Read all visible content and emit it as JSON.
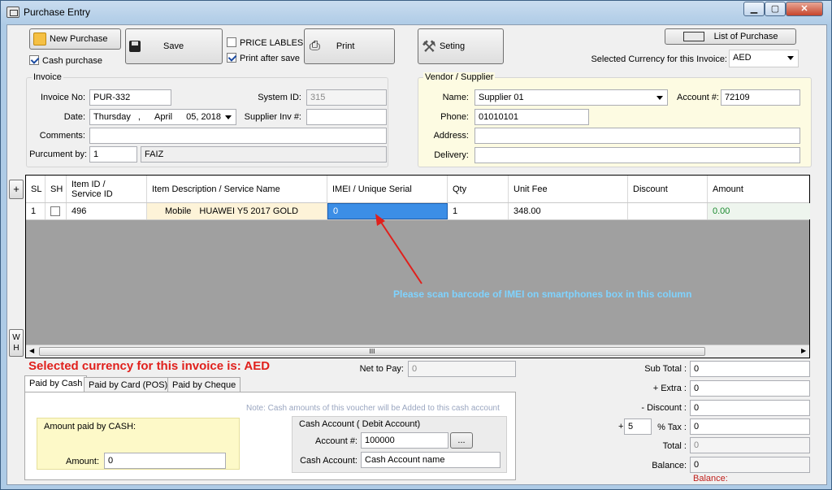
{
  "window": {
    "title": "Purchase Entry",
    "min": "▁",
    "max": "▢",
    "close": "✕"
  },
  "toolbar": {
    "new_purchase": "New Purchase",
    "save": "Save",
    "print": "Print",
    "setting": "Seting",
    "list_of_purchase": "List of Purchase",
    "cash_purchase": "Cash purchase",
    "price_lables": "PRICE LABLES",
    "print_after_save": "Print after save"
  },
  "currency": {
    "label": "Selected Currency for this Invoice:",
    "value": "AED"
  },
  "invoice": {
    "title": "Invoice",
    "invoice_no_label": "Invoice No:",
    "invoice_no": "PUR-332",
    "system_id_label": "System ID:",
    "system_id": "315",
    "date_label": "Date:",
    "date_day": "Thursday",
    "date_sep": ",",
    "date_month": "April",
    "date_rest": "05, 2018",
    "supplier_inv_label": "Supplier Inv #:",
    "supplier_inv": "",
    "comments_label": "Comments:",
    "comments": "",
    "purcument_label": "Purcument by:",
    "purcument_id": "1",
    "purcument_name": "FAIZ"
  },
  "vendor": {
    "title": "Vendor / Supplier",
    "name_label": "Name:",
    "name": "Supplier 01",
    "account_label": "Account #:",
    "account": "72109",
    "phone_label": "Phone:",
    "phone": "01010101",
    "address_label": "Address:",
    "address": "",
    "delivery_label": "Delivery:",
    "delivery": ""
  },
  "grid": {
    "columns": [
      "SL",
      "SH",
      "Item ID /\nService ID",
      "Item Description  / Service Name",
      "IMEI / Unique Serial",
      "Qty",
      "Unit Fee",
      "Discount",
      "Amount"
    ],
    "row": {
      "sl": "1",
      "item_id": "496",
      "desc_type": "Mobile",
      "desc_name": "HUAWEI Y5 2017 GOLD",
      "imei": "0",
      "qty": "1",
      "unit_fee": "348.00",
      "discount": "",
      "amount": "0.00"
    },
    "annotation": "Please scan barcode of IMEI on smartphones box in this column",
    "scroll_grip": "III",
    "plus_btn": "+",
    "wh_btn": "W\nH"
  },
  "currency_banner": "Selected currency for this invoice is: AED",
  "net_to_pay": {
    "label": "Net to Pay:",
    "value": "0"
  },
  "tabs": [
    "Paid by Cash",
    "Paid by Card (POS)",
    "Paid by Cheque"
  ],
  "cash": {
    "note": "Note: Cash amounts of this voucher will be Added to  this cash account",
    "amount_group": "Amount paid by CASH:",
    "amount_label": "Amount:",
    "amount": "0",
    "account_group": "Cash Account ( Debit Account)",
    "account_no_label": "Account #:",
    "account_no": "100000",
    "browse": "...",
    "cash_account_label": "Cash Account:",
    "cash_account": "Cash Account name"
  },
  "totals": {
    "sub_total_label": "Sub Total :",
    "sub_total": "0",
    "extra_label": "+ Extra :",
    "extra": "0",
    "discount_label": "- Discount :",
    "discount": "0",
    "tax_prefix": "+",
    "tax_rate": "5",
    "tax_label": "% Tax :",
    "tax": "0",
    "total_label": "Total :",
    "total": "0",
    "balance_label": "Balance:",
    "balance": "0",
    "balance_red": "Balance:"
  },
  "colors": {
    "accent": "#1f6fd6",
    "banner": "#e0201c",
    "annotation": "#7fd3ff",
    "amount": "#1a8a2e"
  }
}
